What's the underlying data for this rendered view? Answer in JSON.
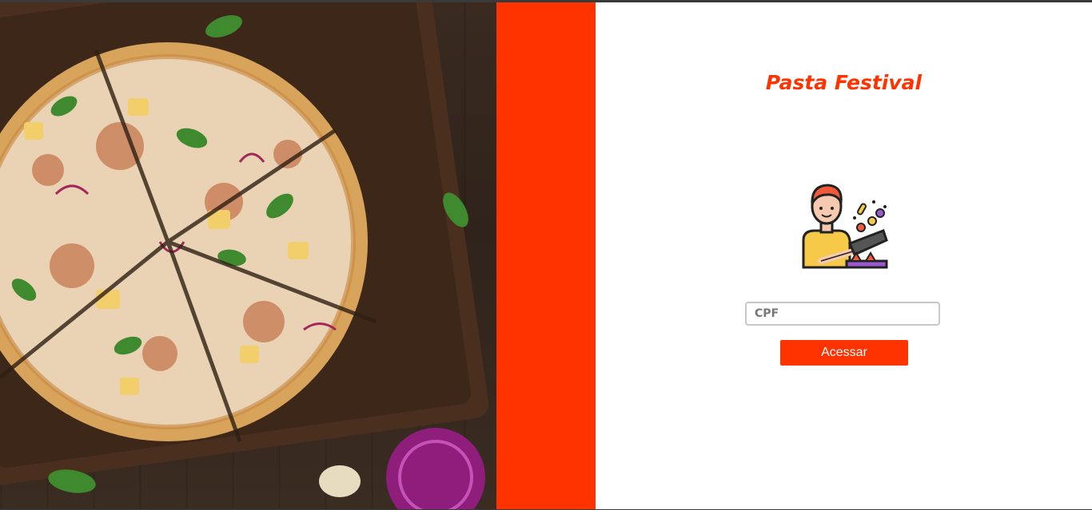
{
  "brand": {
    "title": "Pasta Festival",
    "color": "#ff3300"
  },
  "hero": {
    "image": "pizza-on-wooden-board-photo"
  },
  "login": {
    "cpf_placeholder": "CPF",
    "cpf_value": "",
    "submit_label": "Acessar"
  },
  "icons": {
    "illustration": "chef-cooking-icon"
  }
}
